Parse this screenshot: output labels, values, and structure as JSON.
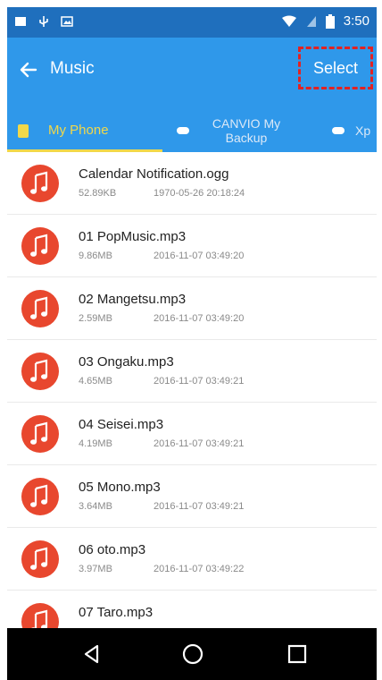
{
  "status_bar": {
    "time": "3:50"
  },
  "app_bar": {
    "title": "Music",
    "select_label": "Select"
  },
  "tabs": [
    {
      "label": "My Phone"
    },
    {
      "label": "CANVIO My Backup"
    },
    {
      "label": "Xp"
    }
  ],
  "files": [
    {
      "name": "Calendar Notification.ogg",
      "size": "52.89KB",
      "date": "1970-05-26 20:18:24"
    },
    {
      "name": "01 PopMusic.mp3",
      "size": "9.86MB",
      "date": "2016-11-07 03:49:20"
    },
    {
      "name": "02 Mangetsu.mp3",
      "size": "2.59MB",
      "date": "2016-11-07 03:49:20"
    },
    {
      "name": "03 Ongaku.mp3",
      "size": "4.65MB",
      "date": "2016-11-07 03:49:21"
    },
    {
      "name": "04 Seisei.mp3",
      "size": "4.19MB",
      "date": "2016-11-07 03:49:21"
    },
    {
      "name": "05 Mono.mp3",
      "size": "3.64MB",
      "date": "2016-11-07 03:49:21"
    },
    {
      "name": "06 oto.mp3",
      "size": "3.97MB",
      "date": "2016-11-07 03:49:22"
    },
    {
      "name": "07 Taro.mp3",
      "size": "",
      "date": ""
    }
  ],
  "colors": {
    "status_bar": "#1f6fbd",
    "app_bar": "#2f98ea",
    "active_tab": "#f1d84a",
    "file_icon": "#e8472e",
    "highlight_box": "#e32222"
  },
  "icons": {
    "back": "arrow-left-icon",
    "file": "music-note-icon",
    "nav_back": "triangle-back-icon",
    "nav_home": "circle-home-icon",
    "nav_recent": "square-recent-icon"
  }
}
